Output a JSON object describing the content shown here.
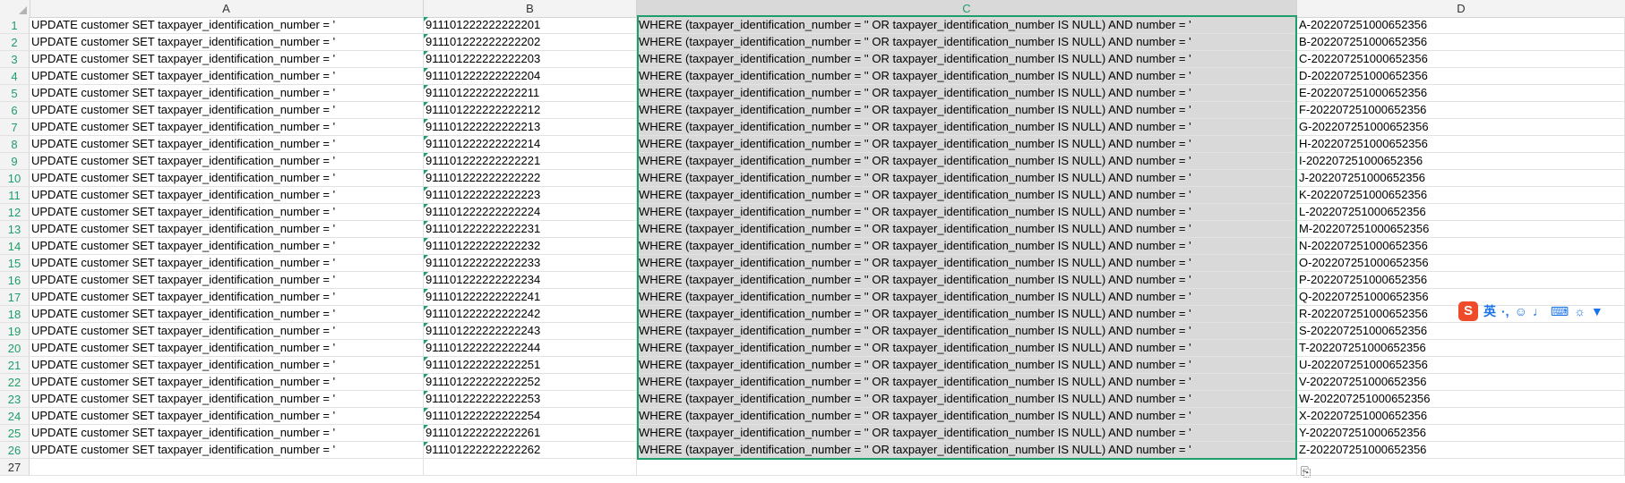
{
  "columns": [
    "A",
    "B",
    "C",
    "D"
  ],
  "active_column": "C",
  "rows": [
    {
      "n": "1",
      "a": "UPDATE customer SET taxpayer_identification_number = '",
      "b": "911101222222222201",
      "c": "WHERE (taxpayer_identification_number = '' OR taxpayer_identification_number IS NULL) AND number = '",
      "d": "A-202207251000652356"
    },
    {
      "n": "2",
      "a": "UPDATE customer SET taxpayer_identification_number = '",
      "b": "911101222222222202",
      "c": "WHERE (taxpayer_identification_number = '' OR taxpayer_identification_number IS NULL) AND number = '",
      "d": "B-202207251000652356"
    },
    {
      "n": "3",
      "a": "UPDATE customer SET taxpayer_identification_number = '",
      "b": "911101222222222203",
      "c": "WHERE (taxpayer_identification_number = '' OR taxpayer_identification_number IS NULL) AND number = '",
      "d": "C-202207251000652356"
    },
    {
      "n": "4",
      "a": "UPDATE customer SET taxpayer_identification_number = '",
      "b": "911101222222222204",
      "c": "WHERE (taxpayer_identification_number = '' OR taxpayer_identification_number IS NULL) AND number = '",
      "d": "D-202207251000652356"
    },
    {
      "n": "5",
      "a": "UPDATE customer SET taxpayer_identification_number = '",
      "b": "911101222222222211",
      "c": "WHERE (taxpayer_identification_number = '' OR taxpayer_identification_number IS NULL) AND number = '",
      "d": "E-202207251000652356"
    },
    {
      "n": "6",
      "a": "UPDATE customer SET taxpayer_identification_number = '",
      "b": "911101222222222212",
      "c": "WHERE (taxpayer_identification_number = '' OR taxpayer_identification_number IS NULL) AND number = '",
      "d": "F-202207251000652356"
    },
    {
      "n": "7",
      "a": "UPDATE customer SET taxpayer_identification_number = '",
      "b": "911101222222222213",
      "c": "WHERE (taxpayer_identification_number = '' OR taxpayer_identification_number IS NULL) AND number = '",
      "d": "G-202207251000652356"
    },
    {
      "n": "8",
      "a": "UPDATE customer SET taxpayer_identification_number = '",
      "b": "911101222222222214",
      "c": "WHERE (taxpayer_identification_number = '' OR taxpayer_identification_number IS NULL) AND number = '",
      "d": "H-202207251000652356"
    },
    {
      "n": "9",
      "a": "UPDATE customer SET taxpayer_identification_number = '",
      "b": "911101222222222221",
      "c": "WHERE (taxpayer_identification_number = '' OR taxpayer_identification_number IS NULL) AND number = '",
      "d": "I-202207251000652356"
    },
    {
      "n": "10",
      "a": "UPDATE customer SET taxpayer_identification_number = '",
      "b": "911101222222222222",
      "c": "WHERE (taxpayer_identification_number = '' OR taxpayer_identification_number IS NULL) AND number = '",
      "d": "J-202207251000652356"
    },
    {
      "n": "11",
      "a": "UPDATE customer SET taxpayer_identification_number = '",
      "b": "911101222222222223",
      "c": "WHERE (taxpayer_identification_number = '' OR taxpayer_identification_number IS NULL) AND number = '",
      "d": "K-202207251000652356"
    },
    {
      "n": "12",
      "a": "UPDATE customer SET taxpayer_identification_number = '",
      "b": "911101222222222224",
      "c": "WHERE (taxpayer_identification_number = '' OR taxpayer_identification_number IS NULL) AND number = '",
      "d": "L-202207251000652356"
    },
    {
      "n": "13",
      "a": "UPDATE customer SET taxpayer_identification_number = '",
      "b": "911101222222222231",
      "c": "WHERE (taxpayer_identification_number = '' OR taxpayer_identification_number IS NULL) AND number = '",
      "d": "M-202207251000652356"
    },
    {
      "n": "14",
      "a": "UPDATE customer SET taxpayer_identification_number = '",
      "b": "911101222222222232",
      "c": "WHERE (taxpayer_identification_number = '' OR taxpayer_identification_number IS NULL) AND number = '",
      "d": "N-202207251000652356"
    },
    {
      "n": "15",
      "a": "UPDATE customer SET taxpayer_identification_number = '",
      "b": "911101222222222233",
      "c": "WHERE (taxpayer_identification_number = '' OR taxpayer_identification_number IS NULL) AND number = '",
      "d": "O-202207251000652356"
    },
    {
      "n": "16",
      "a": "UPDATE customer SET taxpayer_identification_number = '",
      "b": "911101222222222234",
      "c": "WHERE (taxpayer_identification_number = '' OR taxpayer_identification_number IS NULL) AND number = '",
      "d": "P-202207251000652356"
    },
    {
      "n": "17",
      "a": "UPDATE customer SET taxpayer_identification_number = '",
      "b": "911101222222222241",
      "c": "WHERE (taxpayer_identification_number = '' OR taxpayer_identification_number IS NULL) AND number = '",
      "d": "Q-202207251000652356"
    },
    {
      "n": "18",
      "a": "UPDATE customer SET taxpayer_identification_number = '",
      "b": "911101222222222242",
      "c": "WHERE (taxpayer_identification_number = '' OR taxpayer_identification_number IS NULL) AND number = '",
      "d": "R-202207251000652356"
    },
    {
      "n": "19",
      "a": "UPDATE customer SET taxpayer_identification_number = '",
      "b": "911101222222222243",
      "c": "WHERE (taxpayer_identification_number = '' OR taxpayer_identification_number IS NULL) AND number = '",
      "d": "S-202207251000652356"
    },
    {
      "n": "20",
      "a": "UPDATE customer SET taxpayer_identification_number = '",
      "b": "911101222222222244",
      "c": "WHERE (taxpayer_identification_number = '' OR taxpayer_identification_number IS NULL) AND number = '",
      "d": "T-202207251000652356"
    },
    {
      "n": "21",
      "a": "UPDATE customer SET taxpayer_identification_number = '",
      "b": "911101222222222251",
      "c": "WHERE (taxpayer_identification_number = '' OR taxpayer_identification_number IS NULL) AND number = '",
      "d": "U-202207251000652356"
    },
    {
      "n": "22",
      "a": "UPDATE customer SET taxpayer_identification_number = '",
      "b": "911101222222222252",
      "c": "WHERE (taxpayer_identification_number = '' OR taxpayer_identification_number IS NULL) AND number = '",
      "d": "V-202207251000652356"
    },
    {
      "n": "23",
      "a": "UPDATE customer SET taxpayer_identification_number = '",
      "b": "911101222222222253",
      "c": "WHERE (taxpayer_identification_number = '' OR taxpayer_identification_number IS NULL) AND number = '",
      "d": "W-202207251000652356"
    },
    {
      "n": "24",
      "a": "UPDATE customer SET taxpayer_identification_number = '",
      "b": "911101222222222254",
      "c": "WHERE (taxpayer_identification_number = '' OR taxpayer_identification_number IS NULL) AND number = '",
      "d": "X-202207251000652356"
    },
    {
      "n": "25",
      "a": "UPDATE customer SET taxpayer_identification_number = '",
      "b": "911101222222222261",
      "c": "WHERE (taxpayer_identification_number = '' OR taxpayer_identification_number IS NULL) AND number = '",
      "d": "Y-202207251000652356"
    },
    {
      "n": "26",
      "a": "UPDATE customer SET taxpayer_identification_number = '",
      "b": "911101222222222262",
      "c": "WHERE (taxpayer_identification_number = '' OR taxpayer_identification_number IS NULL) AND number = '",
      "d": "Z-202207251000652356"
    },
    {
      "n": "27",
      "a": "",
      "b": "",
      "c": "",
      "d": ""
    }
  ],
  "ime_toolbar": {
    "logo": "S",
    "mode": "英",
    "punct": "·,",
    "items": [
      "☺",
      "♩",
      "⌨",
      "☼",
      "▼"
    ]
  },
  "paste_options": "⎘"
}
